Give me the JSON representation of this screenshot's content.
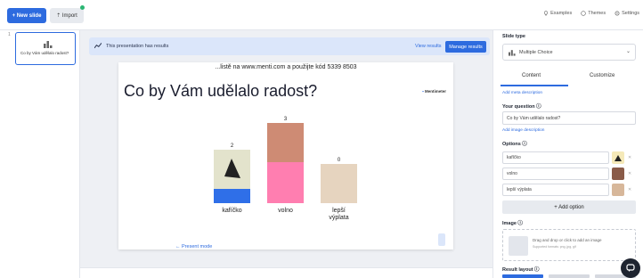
{
  "topbar": {
    "new_slide": "+ New slide",
    "import": "⇡ Import",
    "nav": [
      "Examples",
      "Themes",
      "Settings"
    ]
  },
  "sidebar": {
    "slide_number": "1",
    "thumb_title": "Co by Vám udělalo radost?"
  },
  "banner": {
    "text": "This presentation has results",
    "link": "View results",
    "button": "Manage results"
  },
  "slide": {
    "instruction": "...listě na www.menti.com a použijte kód 5339 8503",
    "title": "Co by Vám udělalo radost?",
    "brand": "Mentimeter"
  },
  "chart_data": {
    "type": "bar",
    "categories": [
      "kafíčko",
      "volno",
      "lepší výplata"
    ],
    "values": [
      2,
      3,
      0
    ],
    "colors": [
      "#2f6fe8",
      "#ff7eb0",
      "#9ad0e8"
    ],
    "title": "Co by Vám udělalo radost?"
  },
  "present_link": "← Present mode",
  "right_panel": {
    "slide_type_label": "Slide type",
    "slide_type_value": "Multiple Choice",
    "tabs": [
      "Content",
      "Customize"
    ],
    "add_description": "Add meta description",
    "question_label": "Your question ⓘ",
    "question_value": "Co by Vám udělalo radost?",
    "add_image_description": "Add image description",
    "options_label": "Options ⓘ",
    "options": [
      "kafíčko",
      "volno",
      "lepší výplata"
    ],
    "add_option": "+ Add option",
    "image_label": "Image ⓘ",
    "dropzone_text": "Drag and drop or click to add an image",
    "dropzone_sub": "Supported formats: png, jpg, gif",
    "result_layout_label": "Result layout ⓘ"
  }
}
